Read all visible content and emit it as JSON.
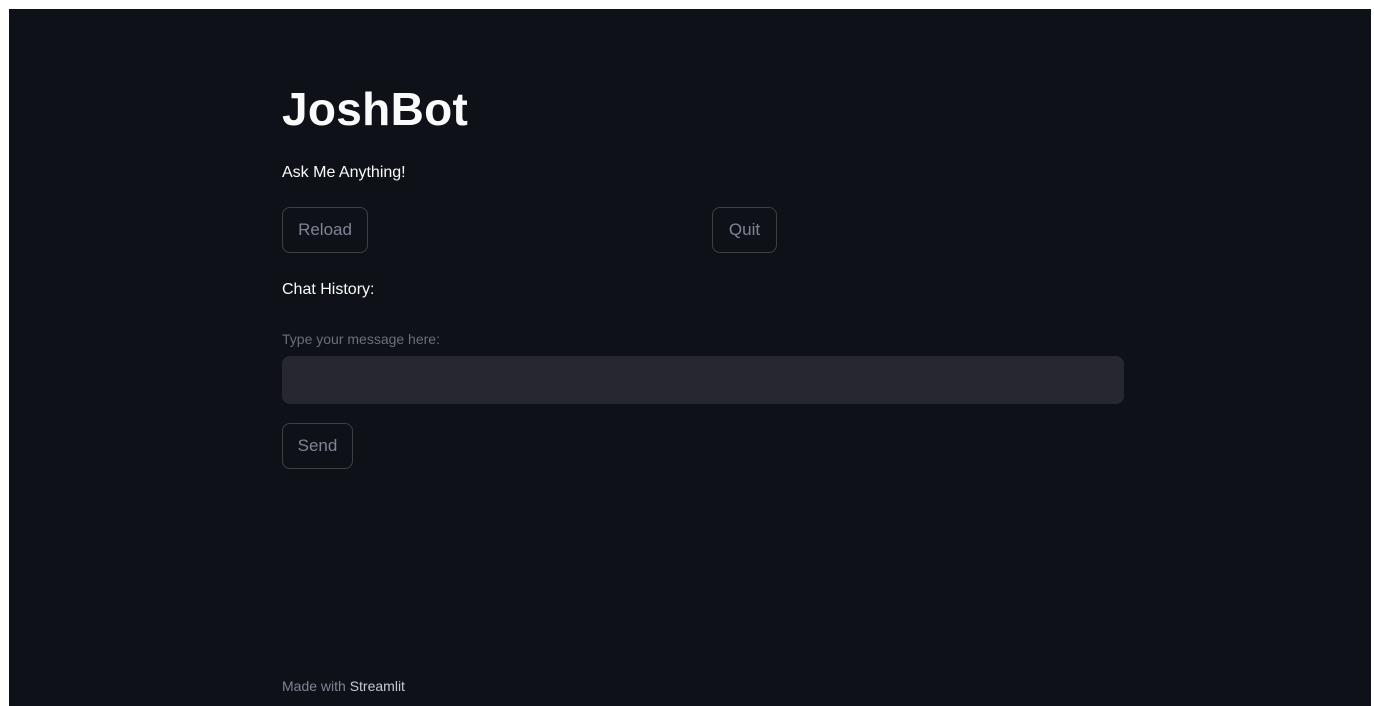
{
  "app": {
    "title": "JoshBot",
    "subtitle": "Ask Me Anything!"
  },
  "buttons": {
    "reload_label": "Reload",
    "quit_label": "Quit",
    "send_label": "Send"
  },
  "chat": {
    "history_label": "Chat History:",
    "input_label": "Type your message here:",
    "input_value": ""
  },
  "footer": {
    "prefix": "Made with ",
    "link_text": "Streamlit"
  },
  "colors": {
    "background": "#0e1117",
    "input_background": "#262730",
    "text_primary": "#fafafa",
    "text_muted": "#808495"
  }
}
